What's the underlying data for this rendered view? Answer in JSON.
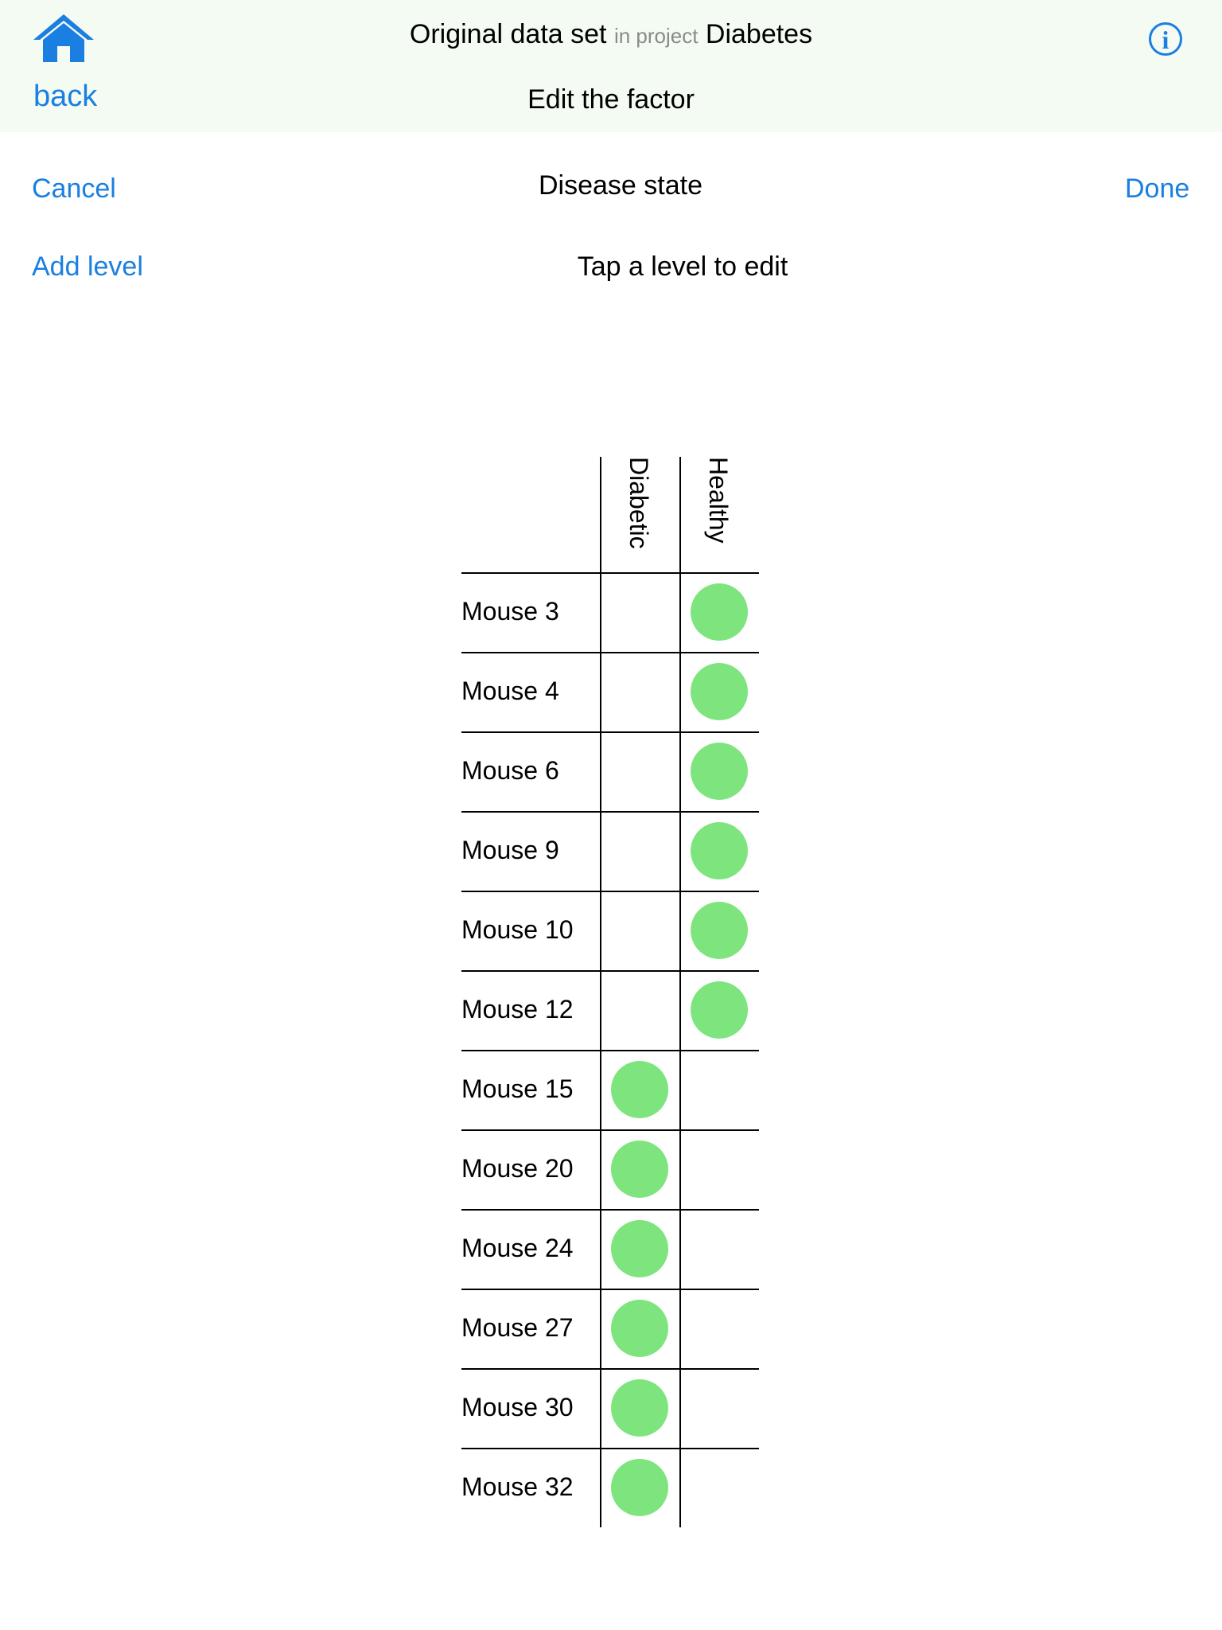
{
  "header": {
    "dataset_name": "Original data set",
    "in_project_label": "in project",
    "project_name": "Diabetes",
    "subtitle": "Edit the factor",
    "back_label": "back",
    "info_glyph": "i",
    "home_icon": "home-icon",
    "info_icon": "info-icon"
  },
  "editor": {
    "cancel_label": "Cancel",
    "factor_name": "Disease state",
    "done_label": "Done",
    "add_level_label": "Add level",
    "hint": "Tap a level to edit"
  },
  "colors": {
    "accent": "#1a7fe0",
    "header_bg": "#f3fbf3",
    "marker": "#7ee57e"
  },
  "levels": [
    "Diabetic",
    "Healthy"
  ],
  "samples": [
    {
      "name": "Mouse 3",
      "level": "Healthy"
    },
    {
      "name": "Mouse 4",
      "level": "Healthy"
    },
    {
      "name": "Mouse 6",
      "level": "Healthy"
    },
    {
      "name": "Mouse 9",
      "level": "Healthy"
    },
    {
      "name": "Mouse 10",
      "level": "Healthy"
    },
    {
      "name": "Mouse 12",
      "level": "Healthy"
    },
    {
      "name": "Mouse 15",
      "level": "Diabetic"
    },
    {
      "name": "Mouse 20",
      "level": "Diabetic"
    },
    {
      "name": "Mouse 24",
      "level": "Diabetic"
    },
    {
      "name": "Mouse 27",
      "level": "Diabetic"
    },
    {
      "name": "Mouse 30",
      "level": "Diabetic"
    },
    {
      "name": "Mouse 32",
      "level": "Diabetic"
    }
  ]
}
